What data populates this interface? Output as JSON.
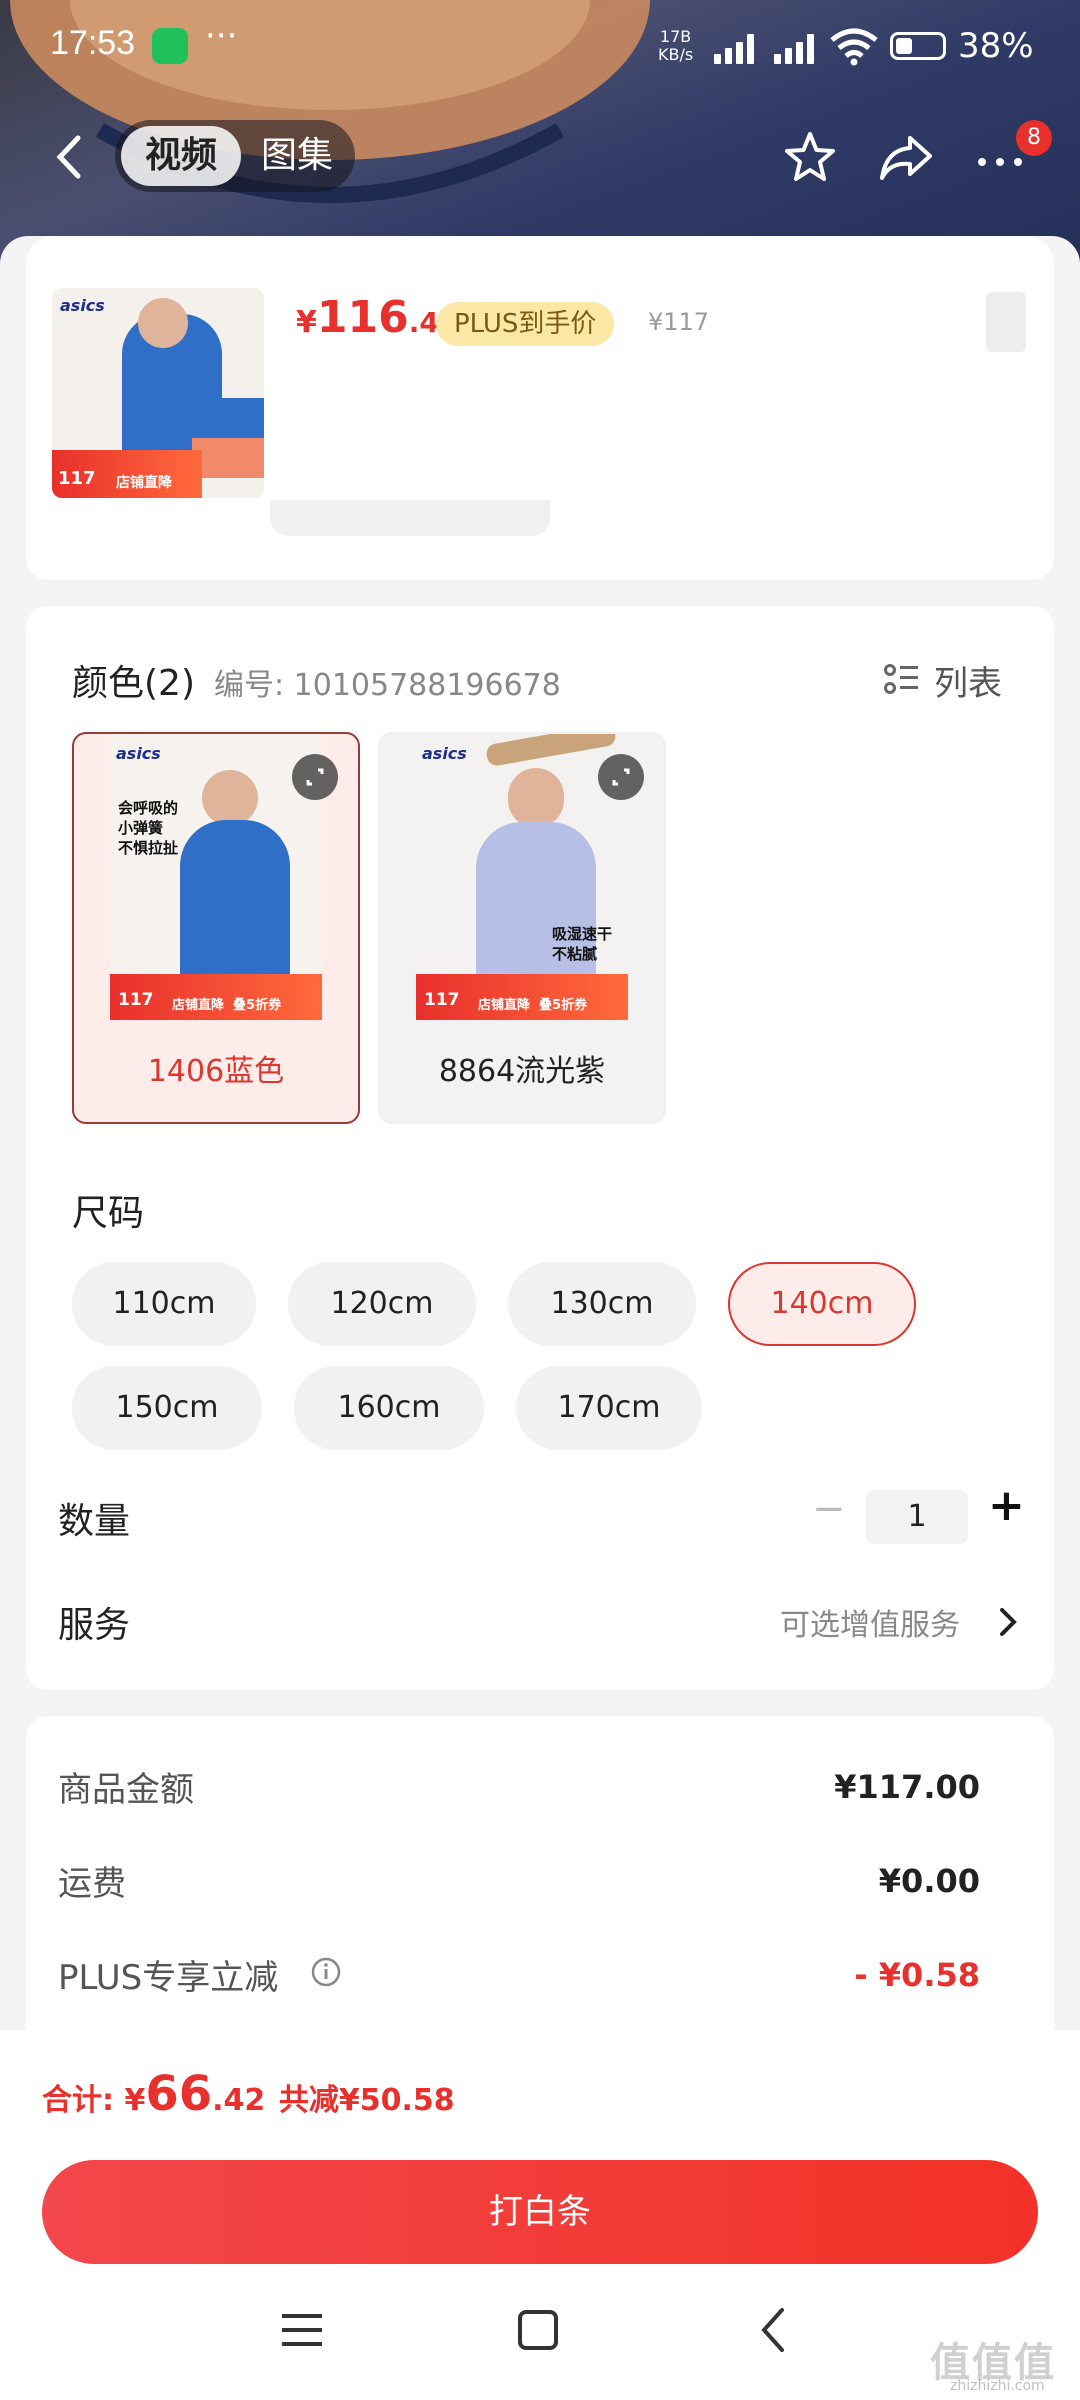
{
  "status_bar": {
    "time": "17:53",
    "network": "17B\nKB/s",
    "battery": "38%"
  },
  "nav": {
    "tab_video": "视频",
    "tab_gallery": "图集",
    "badge_count": "8"
  },
  "product": {
    "price_symbol": "¥",
    "price_int": "116",
    "price_dec": ".42",
    "plus_tag": "PLUS到手价",
    "orig_price": "¥117",
    "thumb_brand": "asics",
    "thumb_price": "117",
    "thumb_promo": "店铺直降"
  },
  "color_section": {
    "title": "颜色(2)",
    "code": "编号: 10105788196678",
    "list_label": "列表",
    "options": [
      {
        "label": "1406蓝色",
        "selected": true,
        "brand": "asics",
        "slogan": "会呼吸的\n小弹簧\n不惧拉扯",
        "price": "117",
        "promo": "店铺直降  叠5折券",
        "accent": "#2f6fc8"
      },
      {
        "label": "8864流光紫",
        "selected": false,
        "brand": "asics",
        "slogan": "吸湿速干\n不粘腻",
        "price": "117",
        "promo": "店铺直降  叠5折券",
        "accent": "#b7bfe6"
      }
    ]
  },
  "size_section": {
    "title": "尺码",
    "sizes": [
      "110cm",
      "120cm",
      "130cm",
      "140cm",
      "150cm",
      "160cm",
      "170cm"
    ],
    "selected": "140cm"
  },
  "quantity": {
    "label": "数量",
    "minus": "−",
    "value": "1",
    "plus": "+"
  },
  "service": {
    "label": "服务",
    "value": "可选增值服务"
  },
  "summary": {
    "goods_label": "商品金额",
    "goods_value": "¥117.00",
    "shipping_label": "运费",
    "shipping_value": "¥0.00",
    "plus_label": "PLUS专享立减",
    "plus_value": "- ¥0.58"
  },
  "total": {
    "label": "合计: ",
    "symbol": "¥",
    "int": "66",
    "dec": ".42",
    "saved": "共减¥50.58"
  },
  "cta": {
    "label": "打白条"
  },
  "watermark": {
    "text": "值值值",
    "url": "zhizhizhi.com"
  },
  "colors": {
    "accent": "#e8302c",
    "cta_start": "#f2474b",
    "cta_end": "#f23227",
    "selected_bg": "#fdecea"
  }
}
